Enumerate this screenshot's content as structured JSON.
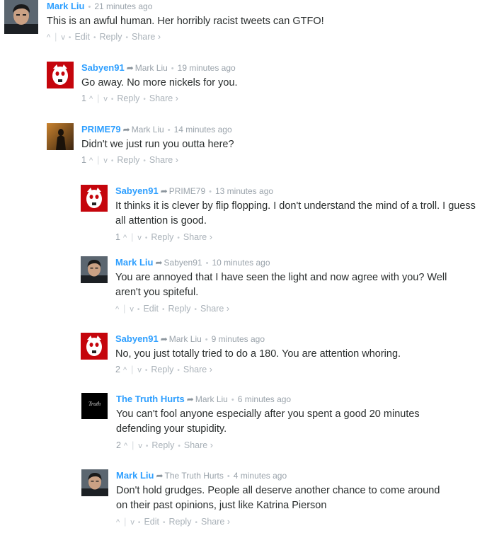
{
  "comments": [
    {
      "author": "Mark Liu",
      "parent": "",
      "time": "21 minutes ago",
      "text": "This is an awful human. Her horribly racist tweets can GTFO!",
      "votes": "",
      "edit": "Edit",
      "reply": "Reply",
      "share": "Share ›",
      "avatar": "person-avatar"
    },
    {
      "author": "Sabyen91",
      "parent": "Mark Liu",
      "time": "19 minutes ago",
      "text": "Go away. No more nickels for you.",
      "votes": "1",
      "edit": "",
      "reply": "Reply",
      "share": "Share ›",
      "avatar": "badger-avatar"
    },
    {
      "author": "PRIME79",
      "parent": "Mark Liu",
      "time": "14 minutes ago",
      "text": "Didn't we just run you outta here?",
      "votes": "1",
      "edit": "",
      "reply": "Reply",
      "share": "Share ›",
      "avatar": "dark-figure-avatar"
    },
    {
      "author": "Sabyen91",
      "parent": "PRIME79",
      "time": "13 minutes ago",
      "text": "It thinks it is clever by flip flopping. I don't understand the mind of a troll. I guess all attention is good.",
      "votes": "1",
      "edit": "",
      "reply": "Reply",
      "share": "Share ›",
      "avatar": "badger-avatar"
    },
    {
      "author": "Mark Liu",
      "parent": "Sabyen91",
      "time": "10 minutes ago",
      "text": "You are annoyed that I have seen the light and now agree with you? Well aren't you spiteful.",
      "votes": "",
      "edit": "Edit",
      "reply": "Reply",
      "share": "Share ›",
      "avatar": "person-avatar"
    },
    {
      "author": "Sabyen91",
      "parent": "Mark Liu",
      "time": "9 minutes ago",
      "text": "No, you just totally tried to do a 180. You are attention whoring.",
      "votes": "2",
      "edit": "",
      "reply": "Reply",
      "share": "Share ›",
      "avatar": "badger-avatar"
    },
    {
      "author": "The Truth Hurts",
      "parent": "Mark Liu",
      "time": "6 minutes ago",
      "text": "You can't fool anyone especially after you spent a good 20 minutes defending your stupidity.",
      "votes": "2",
      "edit": "",
      "reply": "Reply",
      "share": "Share ›",
      "avatar": "truth-avatar",
      "avatar_label": "Truth"
    },
    {
      "author": "Mark Liu",
      "parent": "The Truth Hurts",
      "time": "4 minutes ago",
      "text": "Don't hold grudges. People all deserve another chance to come around on their past opinions, just like Katrina Pierson",
      "votes": "",
      "edit": "Edit",
      "reply": "Reply",
      "share": "Share ›",
      "avatar": "person-avatar"
    }
  ],
  "colors": {
    "author": "#2e9fff",
    "text": "#2a2e2e",
    "meta": "#9aa3ab",
    "badger_red": "#c5050c"
  }
}
